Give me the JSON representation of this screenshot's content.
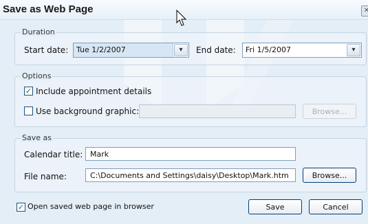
{
  "window": {
    "title": "Save as Web Page",
    "close_label": "✕"
  },
  "duration": {
    "legend": "Duration",
    "start_label": "Start date:",
    "start_value": "Tue 1/2/2007",
    "end_label": "End date:",
    "end_value": "Fri 1/5/2007"
  },
  "options": {
    "legend": "Options",
    "include_details_label": "Include appointment details",
    "include_details_checked": true,
    "use_background_label": "Use background graphic:",
    "use_background_checked": false,
    "background_path": "",
    "browse_label": "Browse..."
  },
  "save_as": {
    "legend": "Save as",
    "calendar_title_label": "Calendar title:",
    "calendar_title_value": "Mark",
    "file_name_label": "File name:",
    "file_name_value": "C:\\Documents and Settings\\daisy\\Desktop\\Mark.htm",
    "browse_label": "Browse..."
  },
  "footer": {
    "open_in_browser_label": "Open saved web page in browser",
    "open_in_browser_checked": true,
    "save_label": "Save",
    "cancel_label": "Cancel"
  },
  "icons": {
    "dropdown": "chevron-down-icon",
    "check": "checkmark-icon",
    "cursor": "mouse-pointer-icon"
  }
}
